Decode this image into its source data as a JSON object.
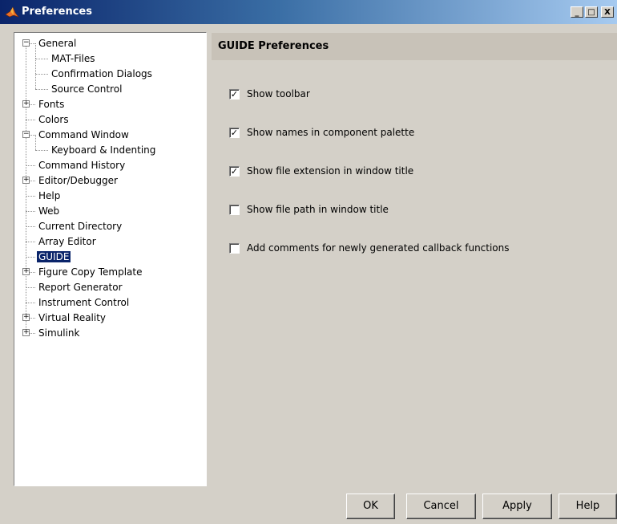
{
  "window": {
    "title": "Preferences",
    "minimize": "_",
    "maximize": "□",
    "close": "X"
  },
  "tree": [
    {
      "label": "General",
      "indent": 0,
      "expander": "-"
    },
    {
      "label": "MAT-Files",
      "indent": 1
    },
    {
      "label": "Confirmation Dialogs",
      "indent": 1
    },
    {
      "label": "Source Control",
      "indent": 1
    },
    {
      "label": "Fonts",
      "indent": 0,
      "expander": "+"
    },
    {
      "label": "Colors",
      "indent": 0
    },
    {
      "label": "Command Window",
      "indent": 0,
      "expander": "-"
    },
    {
      "label": "Keyboard & Indenting",
      "indent": 1
    },
    {
      "label": "Command History",
      "indent": 0
    },
    {
      "label": "Editor/Debugger",
      "indent": 0,
      "expander": "+"
    },
    {
      "label": "Help",
      "indent": 0
    },
    {
      "label": "Web",
      "indent": 0
    },
    {
      "label": "Current Directory",
      "indent": 0
    },
    {
      "label": "Array Editor",
      "indent": 0
    },
    {
      "label": "GUIDE",
      "indent": 0,
      "selected": true
    },
    {
      "label": "Figure Copy Template",
      "indent": 0,
      "expander": "+"
    },
    {
      "label": "Report Generator",
      "indent": 0
    },
    {
      "label": "Instrument Control",
      "indent": 0
    },
    {
      "label": "Virtual Reality",
      "indent": 0,
      "expander": "+"
    },
    {
      "label": "Simulink",
      "indent": 0,
      "expander": "+"
    }
  ],
  "panel": {
    "header": "GUIDE Preferences",
    "options": [
      {
        "label": "Show toolbar",
        "checked": true
      },
      {
        "label": "Show names in component palette",
        "checked": true
      },
      {
        "label": "Show file extension in window title",
        "checked": true
      },
      {
        "label": "Show file path in window title",
        "checked": false
      },
      {
        "label": "Add comments for newly generated callback functions",
        "checked": false
      }
    ]
  },
  "buttons": {
    "ok": "OK",
    "cancel": "Cancel",
    "apply": "Apply",
    "help": "Help"
  },
  "colors": {
    "selection": "#0a246a",
    "dialog_bg": "#d4d0c8",
    "header_bg": "#c8c2b8"
  }
}
